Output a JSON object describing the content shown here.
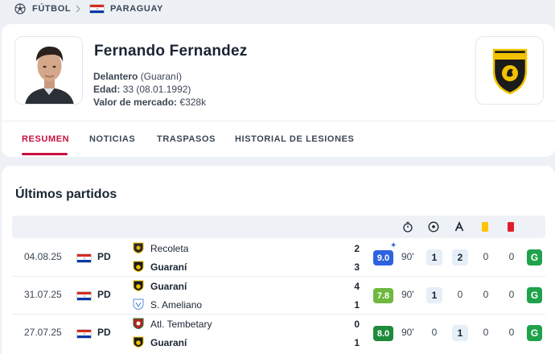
{
  "breadcrumb": {
    "sport": "FÚTBOL",
    "country": "PARAGUAY"
  },
  "player": {
    "name": "Fernando Fernandez",
    "position_label": "Delantero",
    "team_paren": "(Guaraní)",
    "age_label": "Edad:",
    "age_value": "33 (08.01.1992)",
    "market_label": "Valor de mercado:",
    "market_value": "€328k"
  },
  "tabs": [
    "RESUMEN",
    "NOTICIAS",
    "TRASPASOS",
    "HISTORIAL DE LESIONES"
  ],
  "section_title": "Últimos partidos",
  "column_icons": [
    "stopwatch-icon",
    "ball-icon",
    "assist-icon",
    "yellow-card-icon",
    "red-card-icon"
  ],
  "colors": {
    "accent": "#c8103e",
    "rating_blue": "#2d63e0",
    "rating_light_green": "#6fb83f",
    "rating_dark_green": "#1f8a3c",
    "result_win": "#1fa24b"
  },
  "matches": [
    {
      "date": "04.08.25",
      "competition": "PD",
      "home": "Recoleta",
      "away": "Guaraní",
      "home_score": "2",
      "away_score": "3",
      "rating": "9.0",
      "rating_color": "#2d63e0",
      "top_rated": true,
      "minutes": "90'",
      "goals": "1",
      "assists": "2",
      "yellow": "0",
      "red": "0",
      "result": "G"
    },
    {
      "date": "31.07.25",
      "competition": "PD",
      "home": "Guaraní",
      "away": "S. Ameliano",
      "home_score": "4",
      "away_score": "1",
      "rating": "7.8",
      "rating_color": "#6fb83f",
      "top_rated": false,
      "minutes": "90'",
      "goals": "1",
      "assists": "0",
      "yellow": "0",
      "red": "0",
      "result": "G"
    },
    {
      "date": "27.07.25",
      "competition": "PD",
      "home": "Atl. Tembetary",
      "away": "Guaraní",
      "home_score": "0",
      "away_score": "1",
      "rating": "8.0",
      "rating_color": "#1f8a3c",
      "top_rated": false,
      "minutes": "90'",
      "goals": "0",
      "assists": "1",
      "yellow": "0",
      "red": "0",
      "result": "G"
    }
  ]
}
